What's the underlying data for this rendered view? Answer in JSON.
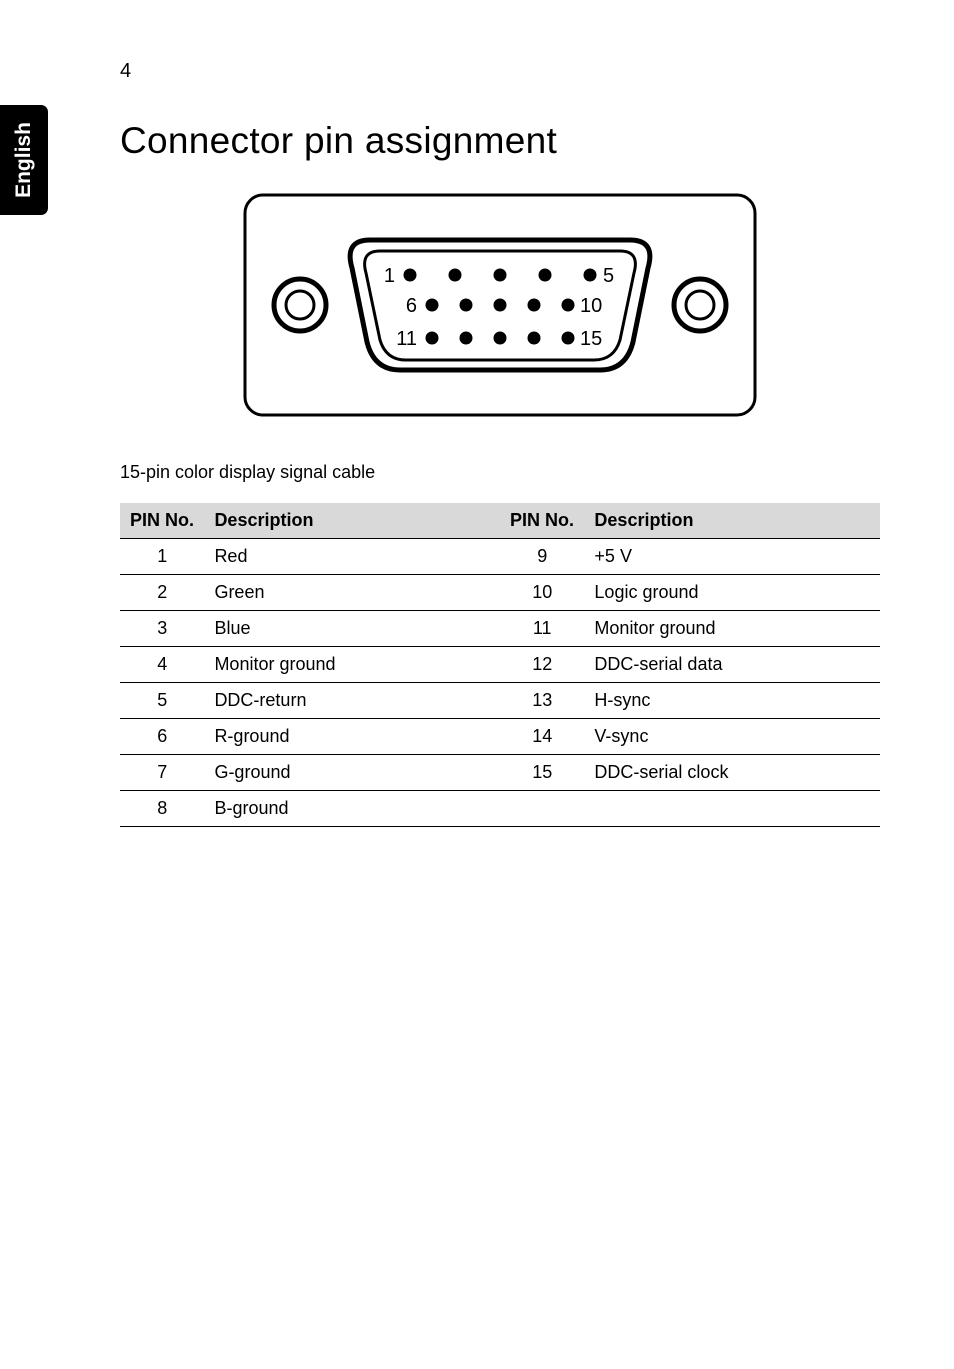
{
  "page_number": "4",
  "side_tab": "English",
  "heading": "Connector pin assignment",
  "caption": "15-pin color display signal cable",
  "table": {
    "headers": {
      "pin_a": "PIN No.",
      "desc_a": "Description",
      "pin_b": "PIN No.",
      "desc_b": "Description"
    },
    "rows": [
      {
        "pin_a": "1",
        "desc_a": "Red",
        "pin_b": "9",
        "desc_b": "+5 V"
      },
      {
        "pin_a": "2",
        "desc_a": "Green",
        "pin_b": "10",
        "desc_b": "Logic ground"
      },
      {
        "pin_a": "3",
        "desc_a": "Blue",
        "pin_b": "11",
        "desc_b": "Monitor ground"
      },
      {
        "pin_a": "4",
        "desc_a": "Monitor ground",
        "pin_b": "12",
        "desc_b": "DDC-serial data"
      },
      {
        "pin_a": "5",
        "desc_a": "DDC-return",
        "pin_b": "13",
        "desc_b": "H-sync"
      },
      {
        "pin_a": "6",
        "desc_a": "R-ground",
        "pin_b": "14",
        "desc_b": "V-sync"
      },
      {
        "pin_a": "7",
        "desc_a": "G-ground",
        "pin_b": "15",
        "desc_b": "DDC-serial clock"
      },
      {
        "pin_a": "8",
        "desc_a": "B-ground",
        "pin_b": "",
        "desc_b": ""
      }
    ]
  },
  "diagram": {
    "row1_start": "1",
    "row1_end": "5",
    "row2_start": "6",
    "row2_end": "10",
    "row3_start": "11",
    "row3_end": "15"
  }
}
